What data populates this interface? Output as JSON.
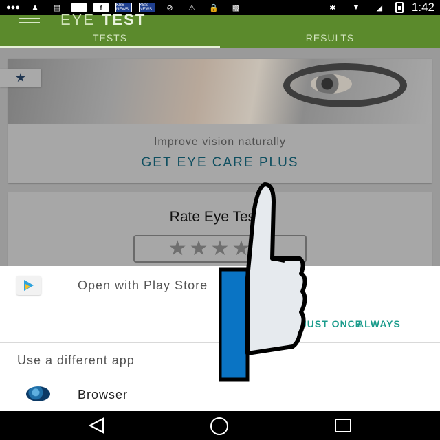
{
  "status_bar": {
    "time": "1:42",
    "left_icons": [
      "dots-icon",
      "person-icon",
      "folder-icon",
      "blank-square-icon",
      "facebook-icon",
      "kbs-news-icon",
      "kbs-news-icon",
      "no-disturb-icon",
      "no-signal-icon",
      "lock-icon",
      "image-icon"
    ],
    "kbs_label": "KBS NEWS",
    "right_icons": [
      "bluetooth-icon",
      "wifi-icon",
      "signal-icon",
      "battery-icon"
    ]
  },
  "app_bar": {
    "title_light": "EYE",
    "title_bold": "TEST",
    "color": "#5b8a2c",
    "tabs": [
      {
        "label": "TESTS",
        "active": true
      },
      {
        "label": "RESULTS",
        "active": false
      }
    ]
  },
  "main": {
    "banner_text": "Improve vision naturally",
    "cta": "GET EYE CARE PLUS",
    "rate_title": "Rate Eye Tests!",
    "stars": [
      "★",
      "★",
      "★",
      "★",
      "★"
    ]
  },
  "sheet": {
    "open_with": "Open with Play Store",
    "once": "JUST ONCE",
    "always": "ALWAYS",
    "accent": "#1b9c8c",
    "different_app": "Use a different app",
    "apps": [
      {
        "name": "Browser",
        "icon": "globe-icon"
      }
    ]
  },
  "overlay": {
    "icon": "thumbs-up-icon",
    "colors": {
      "fill": "#e6eaee",
      "cuff": "#0a74c4",
      "outline": "#000000"
    }
  },
  "nav_bar": {
    "buttons": [
      "back-icon",
      "home-icon",
      "recents-icon"
    ]
  }
}
